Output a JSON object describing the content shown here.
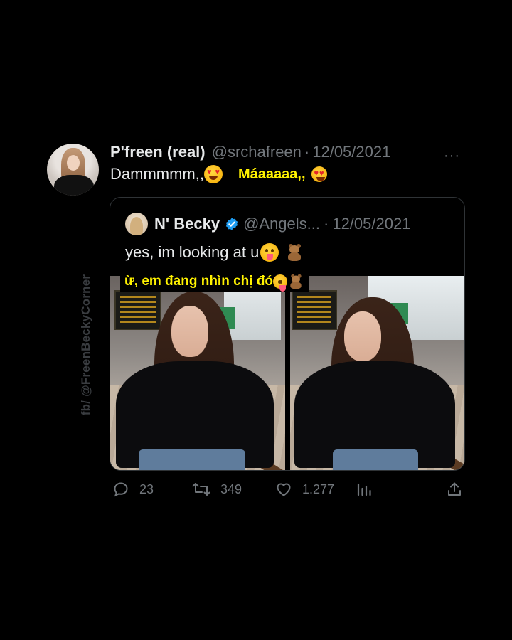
{
  "watermark": "fb/ @FreenBeckyCorner",
  "tweet": {
    "author_name": "P'freen (real)",
    "author_handle": "@srchafreen",
    "separator": "·",
    "date": "12/05/2021",
    "more_label": "···",
    "text": "Dammmmm,,",
    "translation": "Máaaaaa,,"
  },
  "quoted": {
    "author_name": "N' Becky",
    "author_handle": "@Angels...",
    "separator": "·",
    "date": "12/05/2021",
    "text": "yes, im looking at u",
    "translation": "ừ, em đang nhìn chị đó"
  },
  "actions": {
    "replies": "23",
    "retweets": "349",
    "likes": "1.277"
  },
  "icons": [
    "reply-icon",
    "retweet-icon",
    "like-icon",
    "views-icon",
    "share-icon",
    "verified-icon",
    "heart-eyes-emoji",
    "tongue-emoji",
    "teddy-bear-emoji"
  ],
  "colors": {
    "background": "#000000",
    "text": "#e7e9ea",
    "muted": "#71767b",
    "highlight": "#fff200",
    "verified": "#1d9bf0"
  }
}
